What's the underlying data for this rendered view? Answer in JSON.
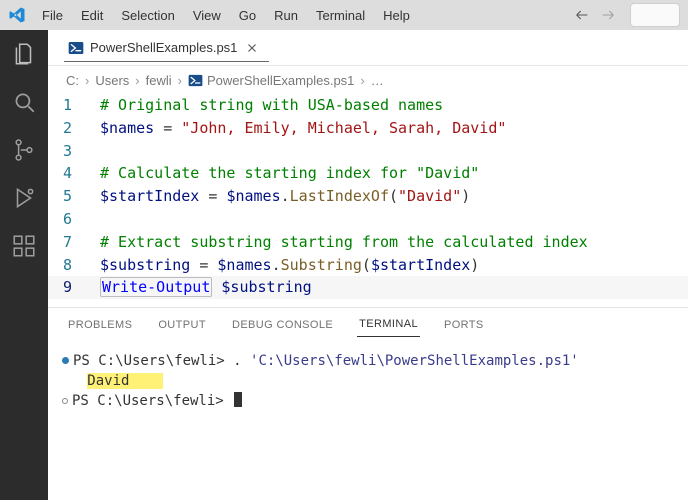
{
  "menu": {
    "items": [
      "File",
      "Edit",
      "Selection",
      "View",
      "Go",
      "Run",
      "Terminal",
      "Help"
    ]
  },
  "tab": {
    "fileName": "PowerShellExamples.ps1"
  },
  "breadcrumb": {
    "c": "C:",
    "users": "Users",
    "fewli": "fewli",
    "file": "PowerShellExamples.ps1",
    "more": "…"
  },
  "editor": {
    "l1": {
      "n": "1",
      "comment": "# Original string with USA-based names"
    },
    "l2": {
      "n": "2",
      "var": "$names",
      "eq": " = ",
      "str": "\"John, Emily, Michael, Sarah, David\""
    },
    "l3": {
      "n": "3"
    },
    "l4": {
      "n": "4",
      "comment": "# Calculate the starting index for \"David\""
    },
    "l5": {
      "n": "5",
      "var": "$startIndex",
      "eq": " = ",
      "var2": "$names",
      "dot": ".",
      "method": "LastIndexOf",
      "open": "(",
      "arg": "\"David\"",
      "close": ")"
    },
    "l6": {
      "n": "6"
    },
    "l7": {
      "n": "7",
      "comment": "# Extract substring starting from the calculated index"
    },
    "l8": {
      "n": "8",
      "var": "$substring",
      "eq": " = ",
      "var2": "$names",
      "dot": ".",
      "method": "Substring",
      "open": "(",
      "arg": "$startIndex",
      "close": ")"
    },
    "l9": {
      "n": "9",
      "cmd": "Write-Output",
      "sp": " ",
      "arg": "$substring"
    }
  },
  "panel": {
    "tabs": {
      "problems": "PROBLEMS",
      "output": "OUTPUT",
      "debug": "DEBUG CONSOLE",
      "terminal": "TERMINAL",
      "ports": "PORTS"
    }
  },
  "terminal": {
    "l1": {
      "prompt": "PS C:\\Users\\fewli> ",
      "cmd": ". ",
      "path": "'C:\\Users\\fewli\\PowerShellExamples.ps1'"
    },
    "l2": {
      "out": "David"
    },
    "l3": {
      "prompt": "PS C:\\Users\\fewli> "
    }
  }
}
